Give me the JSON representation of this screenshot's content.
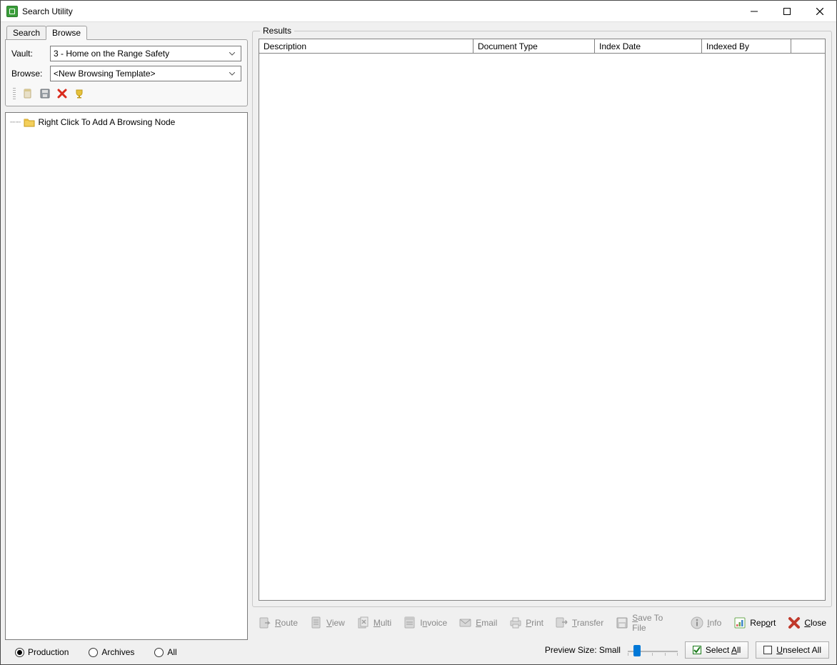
{
  "window": {
    "title": "Search Utility"
  },
  "tabs": {
    "search": "Search",
    "browse": "Browse",
    "active": "browse"
  },
  "form": {
    "vault_label": "Vault:",
    "vault_value": "3 - Home on the Range Safety",
    "browse_label": "Browse:",
    "browse_value": "<New Browsing Template>"
  },
  "tree": {
    "root_label": "Right Click To Add A Browsing Node"
  },
  "radios": {
    "production": "Production",
    "archives": "Archives",
    "all": "All",
    "selected": "production"
  },
  "results": {
    "group_label": "Results",
    "columns": {
      "description": "Description",
      "document_type": "Document Type",
      "index_date": "Index Date",
      "indexed_by": "Indexed By"
    },
    "rows": []
  },
  "actions": {
    "route": "Route",
    "view": "View",
    "multi": "Multi",
    "invoice": "Invoice",
    "email": "Email",
    "print": "Print",
    "transfer": "Transfer",
    "save_to_file": "Save To File",
    "info": "Info",
    "report": "Report",
    "close": "Close"
  },
  "preview": {
    "label": "Preview Size: Small",
    "select_all": "Select All",
    "unselect_all": "Unselect All"
  }
}
